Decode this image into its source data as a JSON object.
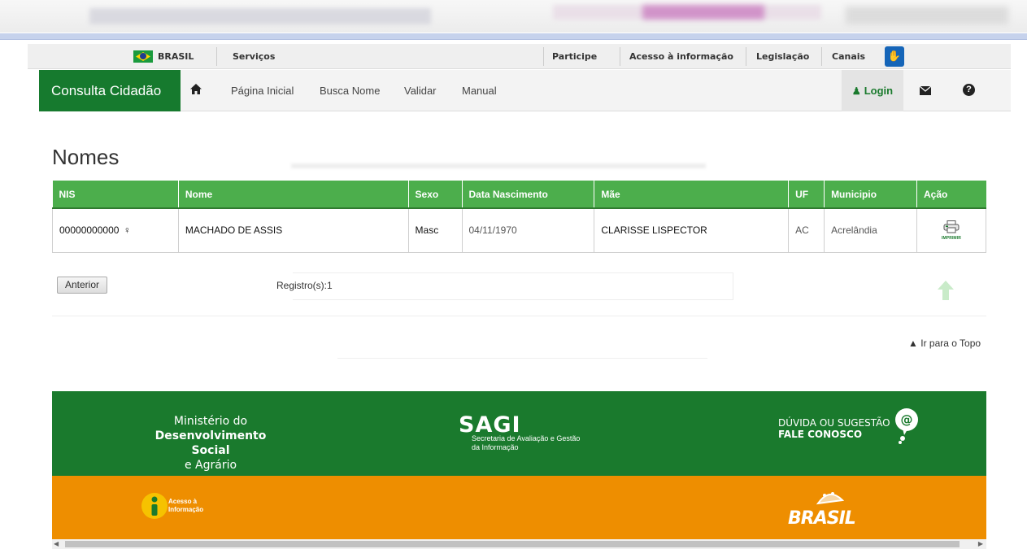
{
  "gov_bar": {
    "country": "BRASIL",
    "services": "Serviços",
    "links": [
      "Participe",
      "Acesso à informação",
      "Legislação",
      "Canais"
    ]
  },
  "app_nav": {
    "brand": "Consulta Cidadão",
    "items": [
      "Página Inicial",
      "Busca Nome",
      "Validar",
      "Manual"
    ],
    "login": "Login"
  },
  "page": {
    "title": "Nomes"
  },
  "table": {
    "headers": [
      "NIS",
      "Nome",
      "Sexo",
      "Data Nascimento",
      "Mãe",
      "UF",
      "Municipio",
      "Ação"
    ],
    "rows": [
      {
        "nis": "00000000000",
        "nome": "MACHADO DE ASSIS",
        "sexo": "Masc",
        "data_nascimento": "04/11/1970",
        "mae": "CLARISSE LISPECTOR",
        "uf": "AC",
        "municipio": "Acrelândia",
        "acao": "IMPRIMIR"
      }
    ]
  },
  "pagination": {
    "prev_label": "Anterior",
    "records": "Registro(s):1"
  },
  "back_to_top": "Ir para o Topo",
  "footer": {
    "ministry_line1": "Ministério do",
    "ministry_line2": "Desenvolvimento Social",
    "ministry_line3": "e Agrário",
    "sagi_title": "SAGI",
    "sagi_line1": "Secretaria de Avaliação e Gestão",
    "sagi_line2": "da Informação",
    "contact_line1": "DÚVIDA OU SUGESTÃO",
    "contact_line2": "FALE CONOSCO",
    "info_line1": "Acesso à",
    "info_line2": "Informação",
    "brasil_logo": "BRASIL"
  },
  "colors": {
    "primary_green": "#167a2e",
    "table_header_green": "#4cae4c",
    "footer_orange": "#ee8e00"
  }
}
